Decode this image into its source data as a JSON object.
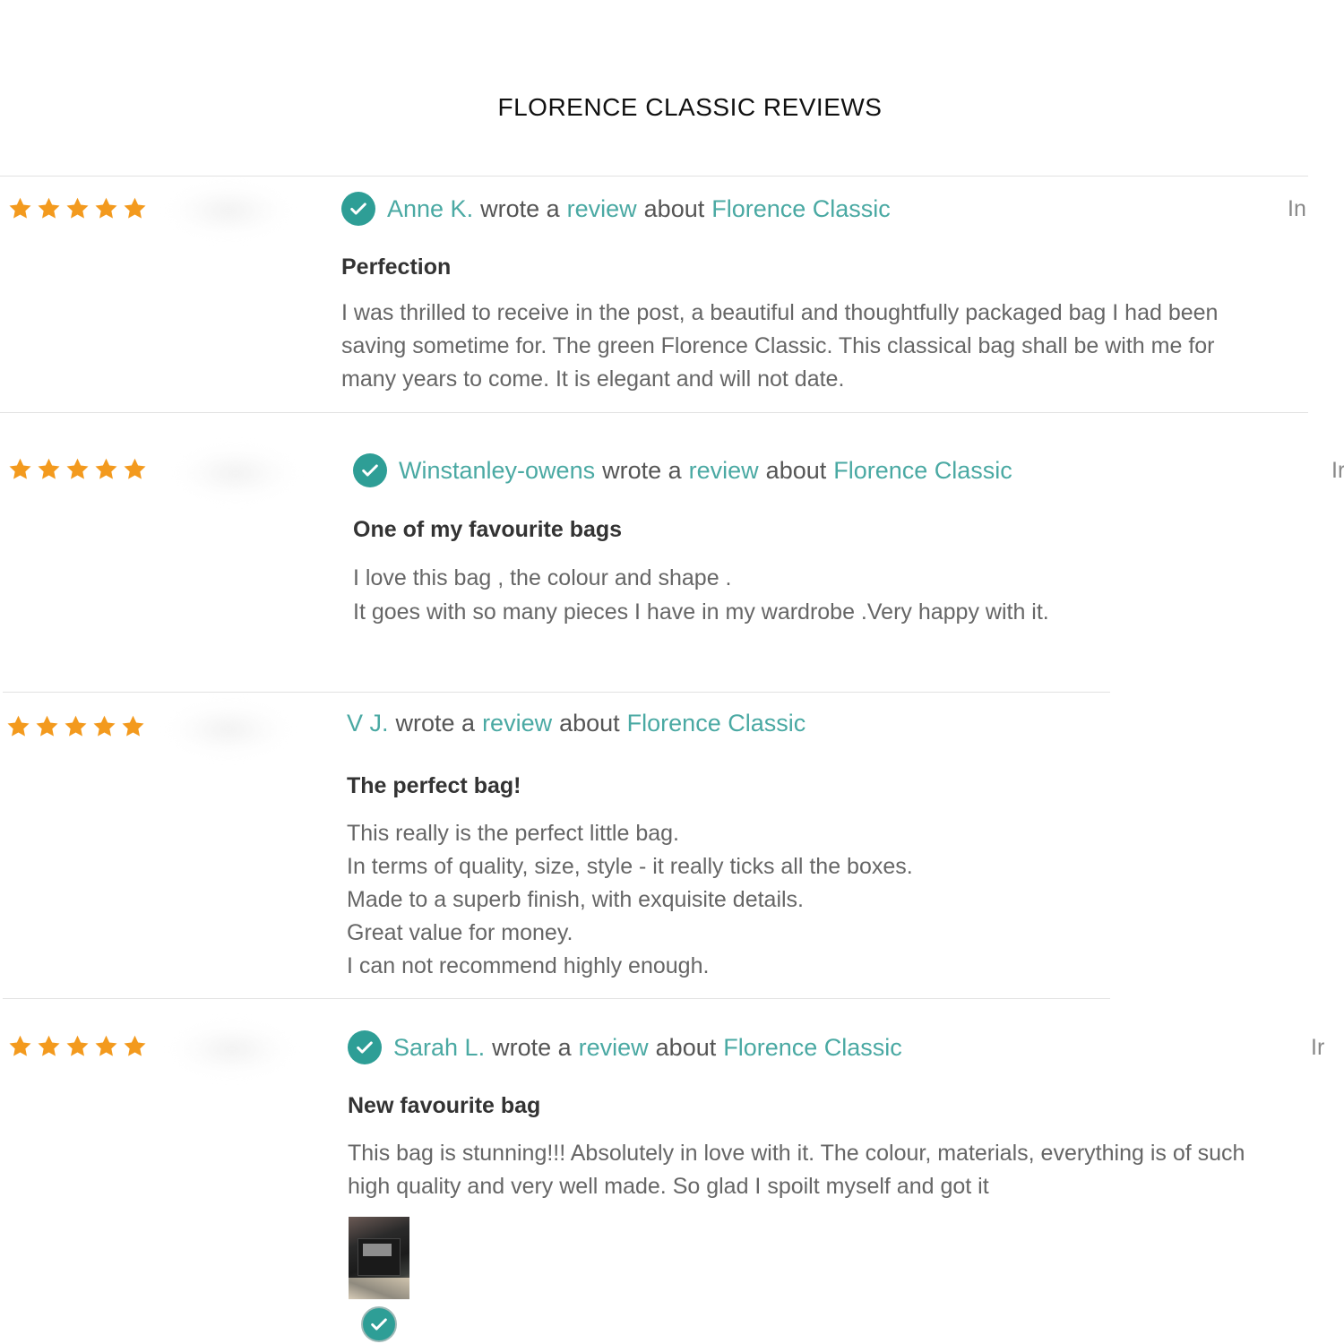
{
  "page": {
    "title": "FLORENCE CLASSIC REVIEWS"
  },
  "reviews": [
    {
      "rating": 5,
      "author": "Anne K.",
      "wrote_a": "wrote a",
      "review_link": "review",
      "about": "about",
      "product": "Florence Classic",
      "title": "Perfection",
      "body": [
        "I was thrilled to receive in the post, a beautiful and thoughtfully packaged bag I had been",
        "saving sometime for. The green Florence Classic. This classical bag shall be with me for",
        "many years to come. It is elegant and will not date."
      ],
      "edge_text": "In"
    },
    {
      "rating": 5,
      "author": "Winstanley-owens",
      "wrote_a": "wrote a",
      "review_link": "review",
      "about": "about",
      "product": "Florence Classic",
      "title": "One of my favourite bags",
      "body": [
        "I love this bag , the colour and shape .",
        "It goes with so many pieces I have in my wardrobe .Very happy with it."
      ],
      "edge_text": "Ir"
    },
    {
      "rating": 5,
      "author": "V J.",
      "wrote_a": "wrote a",
      "review_link": "review",
      "about": "about",
      "product": "Florence Classic",
      "title": "The perfect bag!",
      "body": [
        "This really is the perfect little bag.",
        "In terms of quality, size, style - it really ticks all the boxes.",
        "Made to a superb finish, with exquisite details.",
        "Great value for money.",
        "I can not recommend highly enough."
      ]
    },
    {
      "rating": 5,
      "author": "Sarah L.",
      "wrote_a": "wrote a",
      "review_link": "review",
      "about": "about",
      "product": "Florence Classic",
      "title": "New favourite bag",
      "body": [
        "This bag is stunning!!! Absolutely in love with it. The colour, materials, everything is of such",
        "high quality and very well made. So glad I spoilt myself and got it"
      ],
      "edge_text": "Ir",
      "has_photo": true
    }
  ],
  "colors": {
    "star": "#f39a1e",
    "teal_link": "#4aa9a3",
    "check_badge": "#2e9e96"
  },
  "icons": {
    "star": "star-icon",
    "verified": "verified-check-icon"
  }
}
